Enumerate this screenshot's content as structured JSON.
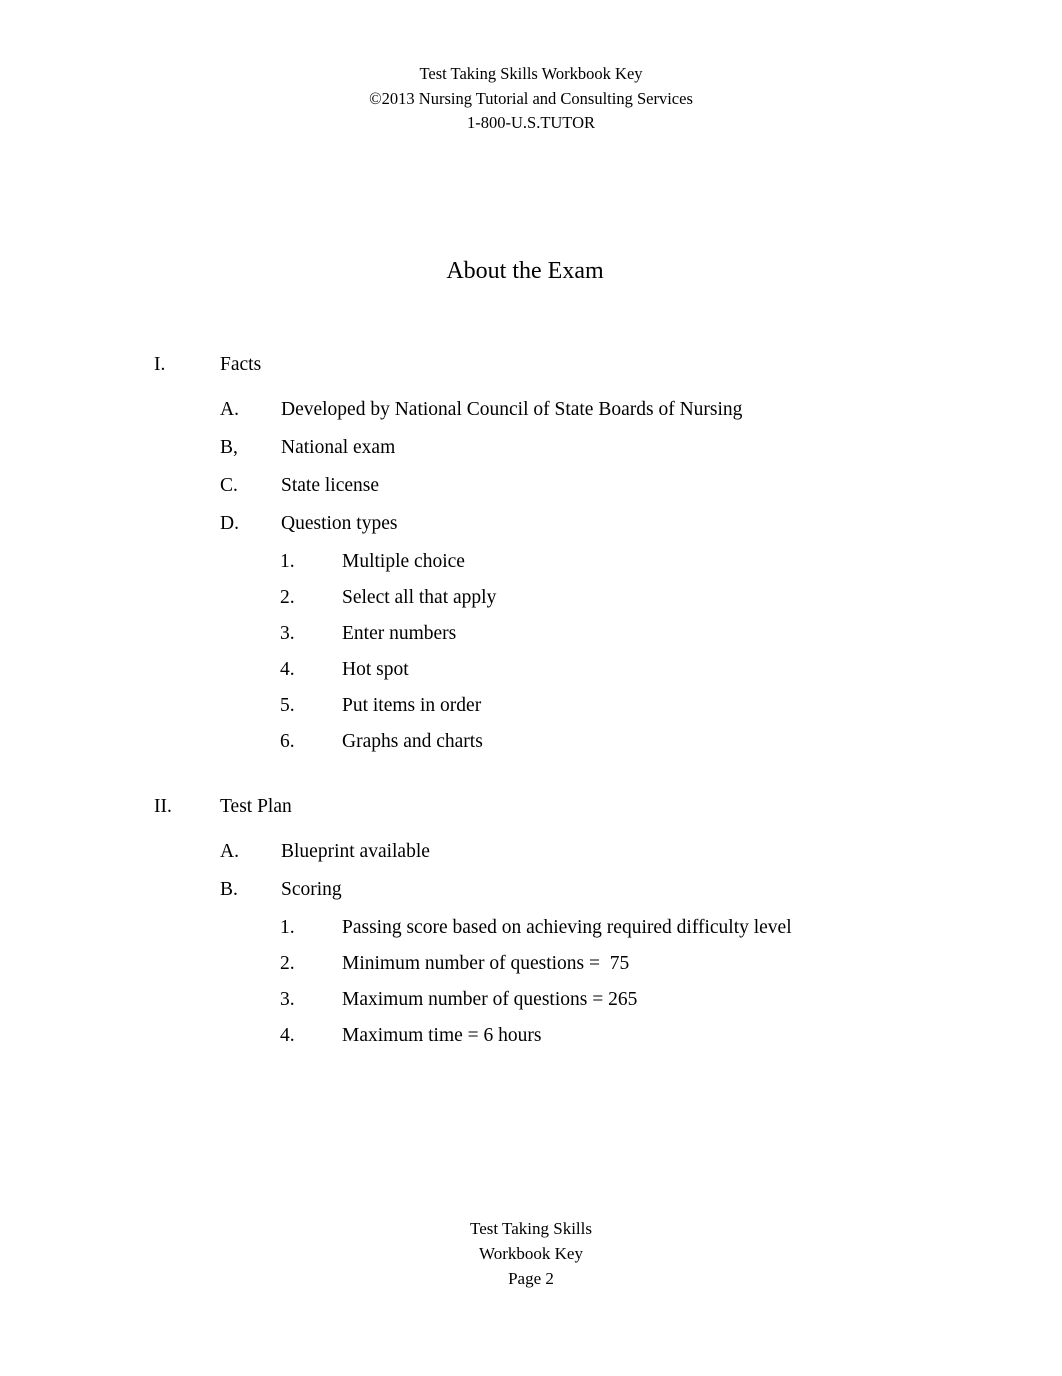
{
  "header": {
    "lines": [
      "Test Taking Skills Workbook Key",
      "©2013 Nursing Tutorial and Consulting Services",
      "1-800-U.S.TUTOR"
    ]
  },
  "title": "About the Exam",
  "sections": [
    {
      "marker": "I.",
      "label": "Facts",
      "items": [
        {
          "marker": "A.",
          "label": "Developed by National Council of State Boards of Nursing"
        },
        {
          "marker": "B,",
          "label": "National exam"
        },
        {
          "marker": "C.",
          "label": "State license"
        },
        {
          "marker": "D.",
          "label": "Question types",
          "subitems": [
            {
              "marker": "1.",
              "label": "Multiple choice"
            },
            {
              "marker": "2.",
              "label": "Select all that apply"
            },
            {
              "marker": "3.",
              "label": "Enter numbers"
            },
            {
              "marker": "4.",
              "label": "Hot spot"
            },
            {
              "marker": "5.",
              "label": "Put items in order"
            },
            {
              "marker": "6.",
              "label": "Graphs and charts"
            }
          ]
        }
      ]
    },
    {
      "marker": "II.",
      "label": "Test Plan",
      "items": [
        {
          "marker": "A.",
          "label": "Blueprint available"
        },
        {
          "marker": "B.",
          "label": "Scoring",
          "subitems": [
            {
              "marker": "1.",
              "label": "Passing score based on achieving required difficulty level"
            },
            {
              "marker": "2.",
              "label": "Minimum number of questions =  75"
            },
            {
              "marker": "3.",
              "label": "Maximum number of questions = 265"
            },
            {
              "marker": "4.",
              "label": "Maximum time = 6 hours"
            }
          ]
        }
      ]
    }
  ],
  "footer": {
    "lines": [
      "Test Taking Skills",
      "Workbook Key",
      "Page 2"
    ]
  }
}
